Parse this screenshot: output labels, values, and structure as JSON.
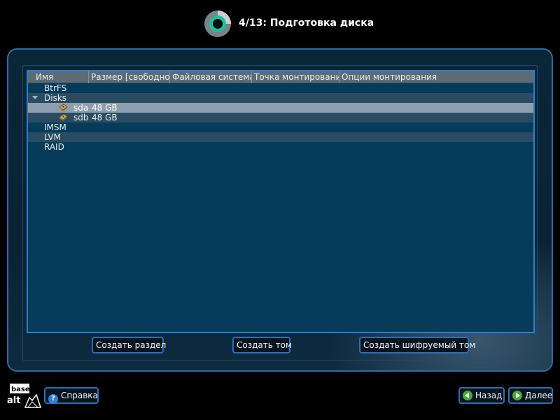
{
  "header": {
    "title": "4/13: Подготовка диска"
  },
  "tree": {
    "columns": [
      "Имя",
      "Размер [свободно]",
      "Файловая система",
      "Точка монтирования",
      "Опции монтирования"
    ],
    "rows": [
      {
        "name": "BtrFS"
      },
      {
        "name": "Disks",
        "expanded": true
      },
      {
        "name": "sda",
        "size": "48 GB",
        "selected": true
      },
      {
        "name": "sdb",
        "size": "48 GB"
      },
      {
        "name": "IMSM"
      },
      {
        "name": "LVM"
      },
      {
        "name": "RAID"
      }
    ]
  },
  "actions": {
    "create_partition": "Создать раздел",
    "create_volume": "Создать том",
    "create_encrypted_volume": "Создать шифруемый том"
  },
  "footer": {
    "logo_text_top": "base",
    "logo_text_bottom": "alt",
    "help": "Справка",
    "back": "Назад",
    "next": "Далее"
  },
  "colors": {
    "accent": "#2a7fd0",
    "tree_bg": "#063b5a",
    "selection": "#8d9fae",
    "logo_teal": "#1fbf9a"
  }
}
